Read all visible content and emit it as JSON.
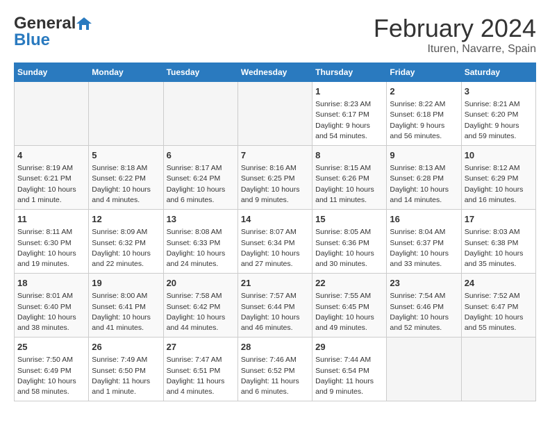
{
  "header": {
    "logo_general": "General",
    "logo_blue": "Blue",
    "title": "February 2024",
    "subtitle": "Ituren, Navarre, Spain"
  },
  "days_of_week": [
    "Sunday",
    "Monday",
    "Tuesday",
    "Wednesday",
    "Thursday",
    "Friday",
    "Saturday"
  ],
  "weeks": [
    [
      {
        "day": "",
        "info": ""
      },
      {
        "day": "",
        "info": ""
      },
      {
        "day": "",
        "info": ""
      },
      {
        "day": "",
        "info": ""
      },
      {
        "day": "1",
        "info": "Sunrise: 8:23 AM\nSunset: 6:17 PM\nDaylight: 9 hours and 54 minutes."
      },
      {
        "day": "2",
        "info": "Sunrise: 8:22 AM\nSunset: 6:18 PM\nDaylight: 9 hours and 56 minutes."
      },
      {
        "day": "3",
        "info": "Sunrise: 8:21 AM\nSunset: 6:20 PM\nDaylight: 9 hours and 59 minutes."
      }
    ],
    [
      {
        "day": "4",
        "info": "Sunrise: 8:19 AM\nSunset: 6:21 PM\nDaylight: 10 hours and 1 minute."
      },
      {
        "day": "5",
        "info": "Sunrise: 8:18 AM\nSunset: 6:22 PM\nDaylight: 10 hours and 4 minutes."
      },
      {
        "day": "6",
        "info": "Sunrise: 8:17 AM\nSunset: 6:24 PM\nDaylight: 10 hours and 6 minutes."
      },
      {
        "day": "7",
        "info": "Sunrise: 8:16 AM\nSunset: 6:25 PM\nDaylight: 10 hours and 9 minutes."
      },
      {
        "day": "8",
        "info": "Sunrise: 8:15 AM\nSunset: 6:26 PM\nDaylight: 10 hours and 11 minutes."
      },
      {
        "day": "9",
        "info": "Sunrise: 8:13 AM\nSunset: 6:28 PM\nDaylight: 10 hours and 14 minutes."
      },
      {
        "day": "10",
        "info": "Sunrise: 8:12 AM\nSunset: 6:29 PM\nDaylight: 10 hours and 16 minutes."
      }
    ],
    [
      {
        "day": "11",
        "info": "Sunrise: 8:11 AM\nSunset: 6:30 PM\nDaylight: 10 hours and 19 minutes."
      },
      {
        "day": "12",
        "info": "Sunrise: 8:09 AM\nSunset: 6:32 PM\nDaylight: 10 hours and 22 minutes."
      },
      {
        "day": "13",
        "info": "Sunrise: 8:08 AM\nSunset: 6:33 PM\nDaylight: 10 hours and 24 minutes."
      },
      {
        "day": "14",
        "info": "Sunrise: 8:07 AM\nSunset: 6:34 PM\nDaylight: 10 hours and 27 minutes."
      },
      {
        "day": "15",
        "info": "Sunrise: 8:05 AM\nSunset: 6:36 PM\nDaylight: 10 hours and 30 minutes."
      },
      {
        "day": "16",
        "info": "Sunrise: 8:04 AM\nSunset: 6:37 PM\nDaylight: 10 hours and 33 minutes."
      },
      {
        "day": "17",
        "info": "Sunrise: 8:03 AM\nSunset: 6:38 PM\nDaylight: 10 hours and 35 minutes."
      }
    ],
    [
      {
        "day": "18",
        "info": "Sunrise: 8:01 AM\nSunset: 6:40 PM\nDaylight: 10 hours and 38 minutes."
      },
      {
        "day": "19",
        "info": "Sunrise: 8:00 AM\nSunset: 6:41 PM\nDaylight: 10 hours and 41 minutes."
      },
      {
        "day": "20",
        "info": "Sunrise: 7:58 AM\nSunset: 6:42 PM\nDaylight: 10 hours and 44 minutes."
      },
      {
        "day": "21",
        "info": "Sunrise: 7:57 AM\nSunset: 6:44 PM\nDaylight: 10 hours and 46 minutes."
      },
      {
        "day": "22",
        "info": "Sunrise: 7:55 AM\nSunset: 6:45 PM\nDaylight: 10 hours and 49 minutes."
      },
      {
        "day": "23",
        "info": "Sunrise: 7:54 AM\nSunset: 6:46 PM\nDaylight: 10 hours and 52 minutes."
      },
      {
        "day": "24",
        "info": "Sunrise: 7:52 AM\nSunset: 6:47 PM\nDaylight: 10 hours and 55 minutes."
      }
    ],
    [
      {
        "day": "25",
        "info": "Sunrise: 7:50 AM\nSunset: 6:49 PM\nDaylight: 10 hours and 58 minutes."
      },
      {
        "day": "26",
        "info": "Sunrise: 7:49 AM\nSunset: 6:50 PM\nDaylight: 11 hours and 1 minute."
      },
      {
        "day": "27",
        "info": "Sunrise: 7:47 AM\nSunset: 6:51 PM\nDaylight: 11 hours and 4 minutes."
      },
      {
        "day": "28",
        "info": "Sunrise: 7:46 AM\nSunset: 6:52 PM\nDaylight: 11 hours and 6 minutes."
      },
      {
        "day": "29",
        "info": "Sunrise: 7:44 AM\nSunset: 6:54 PM\nDaylight: 11 hours and 9 minutes."
      },
      {
        "day": "",
        "info": ""
      },
      {
        "day": "",
        "info": ""
      }
    ]
  ]
}
